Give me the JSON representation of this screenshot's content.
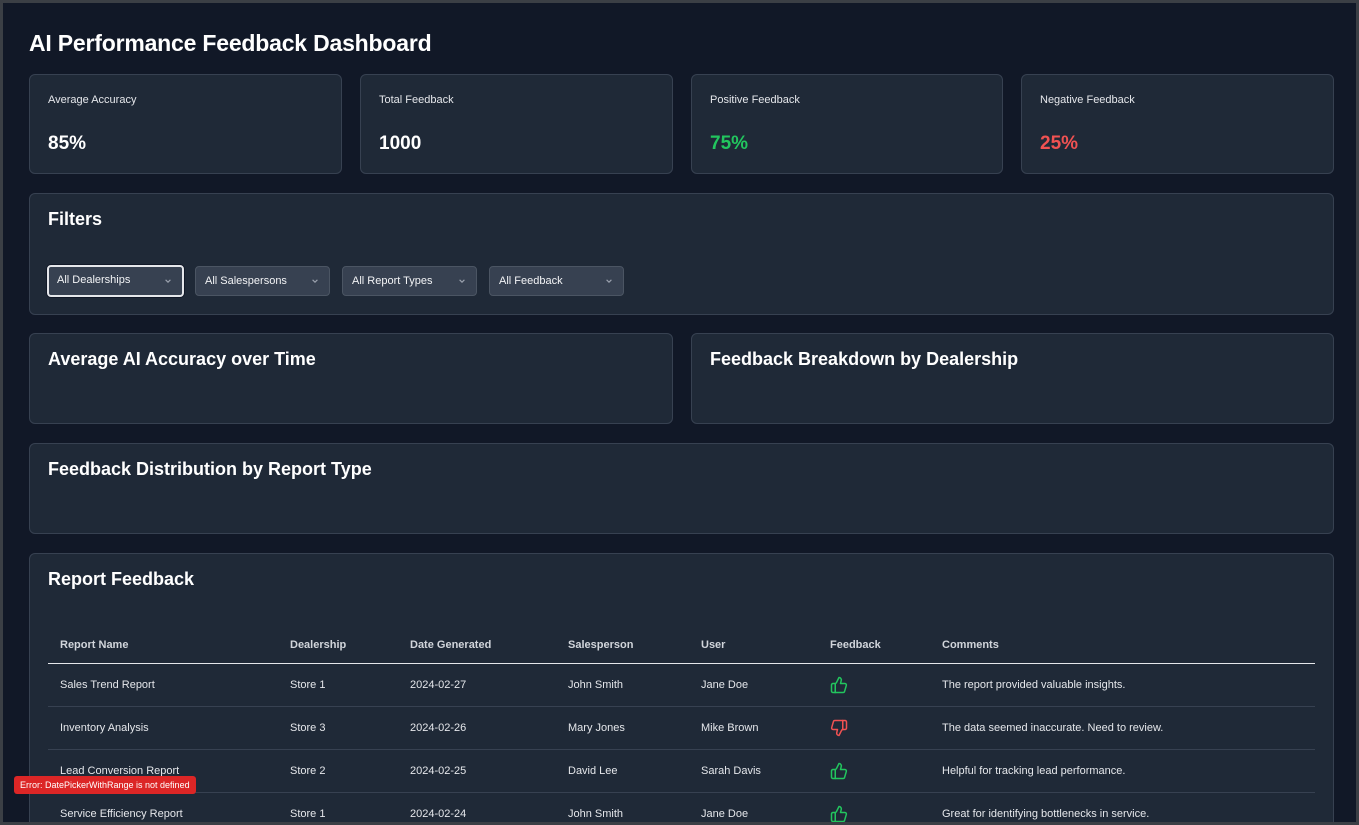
{
  "page": {
    "title": "AI Performance Feedback Dashboard"
  },
  "colors": {
    "positive": "#22c55e",
    "negative": "#f05252",
    "card_bg": "#1f2937",
    "page_bg": "#111827"
  },
  "stats": [
    {
      "label": "Average Accuracy",
      "value": "85%",
      "tone": "neutral"
    },
    {
      "label": "Total Feedback",
      "value": "1000",
      "tone": "neutral"
    },
    {
      "label": "Positive Feedback",
      "value": "75%",
      "tone": "positive"
    },
    {
      "label": "Negative Feedback",
      "value": "25%",
      "tone": "negative"
    }
  ],
  "filters": {
    "title": "Filters",
    "selects": [
      {
        "value": "All Dealerships"
      },
      {
        "value": "All Salespersons"
      },
      {
        "value": "All Report Types"
      },
      {
        "value": "All Feedback"
      }
    ]
  },
  "charts": {
    "accuracy_title": "Average AI Accuracy over Time",
    "dealership_title": "Feedback Breakdown by Dealership",
    "report_type_title": "Feedback Distribution by Report Type"
  },
  "report_feedback": {
    "title": "Report Feedback",
    "columns": [
      "Report Name",
      "Dealership",
      "Date Generated",
      "Salesperson",
      "User",
      "Feedback",
      "Comments"
    ],
    "rows": [
      {
        "report": "Sales Trend Report",
        "dealership": "Store 1",
        "date": "2024-02-27",
        "salesperson": "John Smith",
        "user": "Jane Doe",
        "feedback": "thumbs-up",
        "comment": "The report provided valuable insights."
      },
      {
        "report": "Inventory Analysis",
        "dealership": "Store 3",
        "date": "2024-02-26",
        "salesperson": "Mary Jones",
        "user": "Mike Brown",
        "feedback": "thumbs-down",
        "comment": "The data seemed inaccurate. Need to review."
      },
      {
        "report": "Lead Conversion Report",
        "dealership": "Store 2",
        "date": "2024-02-25",
        "salesperson": "David Lee",
        "user": "Sarah Davis",
        "feedback": "thumbs-up",
        "comment": "Helpful for tracking lead performance."
      },
      {
        "report": "Service Efficiency Report",
        "dealership": "Store 1",
        "date": "2024-02-24",
        "salesperson": "John Smith",
        "user": "Jane Doe",
        "feedback": "thumbs-up",
        "comment": "Great for identifying bottlenecks in service."
      }
    ]
  },
  "error": {
    "message": "Error: DatePickerWithRange is not defined"
  }
}
